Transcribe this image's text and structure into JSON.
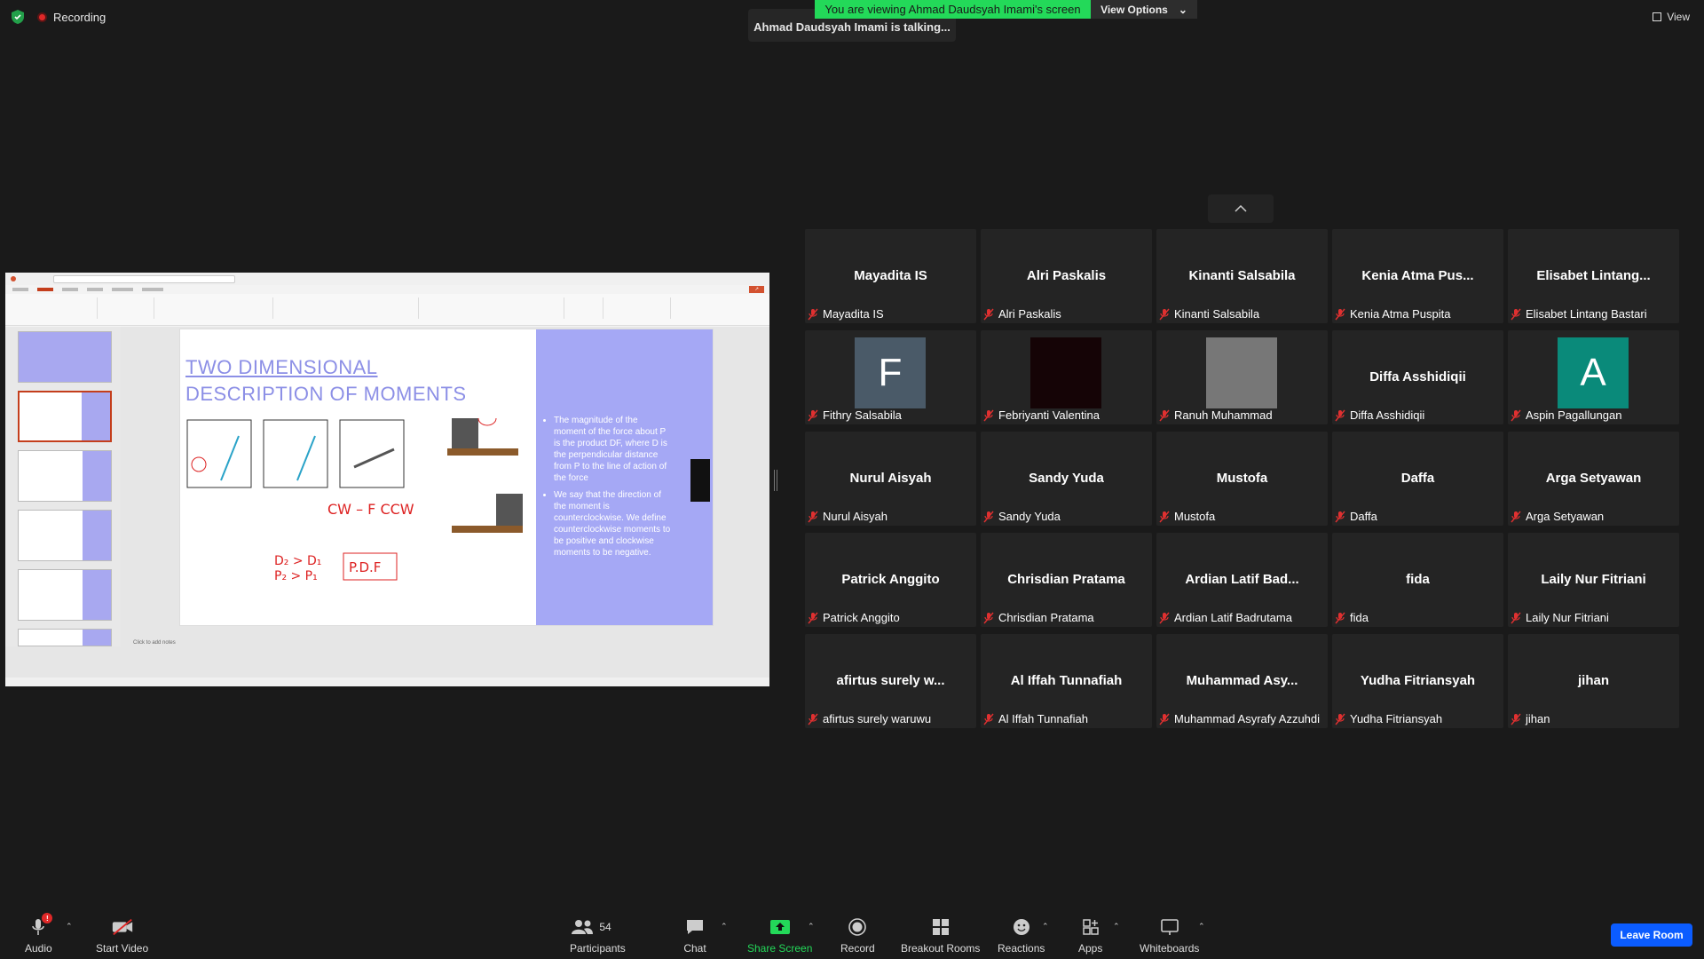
{
  "recording": {
    "label": "Recording"
  },
  "banner": {
    "viewing": "You are viewing Ahmad Daudsyah Imami's screen",
    "view_options": "View Options",
    "talking": "Ahmad Daudsyah Imami is talking..."
  },
  "top_right": {
    "view_label": "View"
  },
  "slide": {
    "title_line1": "TWO DIMENSIONAL",
    "title_line2": "DESCRIPTION OF MOMENTS",
    "bullet1": "The magnitude of the moment of the force about P is the product DF, where D is the perpendicular distance from P to the line of action of the force",
    "bullet2": "We say that the direction of the moment is counterclockwise. We define counterclockwise moments to be positive and clockwise moments to be negative.",
    "notes_placeholder": "Click to add notes"
  },
  "participants_tiles": [
    {
      "big": "Mayadita IS",
      "name": "Mayadita IS"
    },
    {
      "big": "Alri Paskalis",
      "name": "Alri Paskalis"
    },
    {
      "big": "Kinanti Salsabila",
      "name": "Kinanti Salsabila"
    },
    {
      "big": "Kenia Atma Pus...",
      "name": "Kenia Atma Puspita"
    },
    {
      "big": "Elisabet  Lintang...",
      "name": "Elisabet Lintang Bastari"
    },
    {
      "big": "F",
      "name": "Fithry Salsabila",
      "avatar_color": "#4a5a68"
    },
    {
      "big": "",
      "name": "Febriyanti Valentina",
      "avatar_color": "#150406"
    },
    {
      "big": "",
      "name": "Ranuh Muhammad",
      "avatar_color": "#777777"
    },
    {
      "big": "Diffa Asshidiqii",
      "name": "Diffa Asshidiqii"
    },
    {
      "big": "A",
      "name": "Aspin Pagallungan",
      "avatar_color": "#0a8a7a"
    },
    {
      "big": "Nurul Aisyah",
      "name": "Nurul Aisyah"
    },
    {
      "big": "Sandy Yuda",
      "name": "Sandy Yuda"
    },
    {
      "big": "Mustofa",
      "name": "Mustofa"
    },
    {
      "big": "Daffa",
      "name": "Daffa"
    },
    {
      "big": "Arga Setyawan",
      "name": "Arga Setyawan"
    },
    {
      "big": "Patrick Anggito",
      "name": "Patrick Anggito"
    },
    {
      "big": "Chrisdian Pratama",
      "name": "Chrisdian Pratama"
    },
    {
      "big": "Ardian Latif Bad...",
      "name": "Ardian Latif Badrutama"
    },
    {
      "big": "fida",
      "name": "fida"
    },
    {
      "big": "Laily Nur Fitriani",
      "name": "Laily Nur Fitriani"
    },
    {
      "big": "afirtus surely w...",
      "name": "afirtus surely waruwu"
    },
    {
      "big": "Al Iffah Tunnafiah",
      "name": "Al Iffah Tunnafiah"
    },
    {
      "big": "Muhammad  Asy...",
      "name": "Muhammad Asyrafy Azzuhdi"
    },
    {
      "big": "Yudha Fitriansyah",
      "name": "Yudha Fitriansyah"
    },
    {
      "big": "jihan",
      "name": "jihan"
    }
  ],
  "toolbar": {
    "audio": "Audio",
    "audio_badge": "!",
    "start_video": "Start Video",
    "participants": "Participants",
    "participants_count": "54",
    "chat": "Chat",
    "share_screen": "Share Screen",
    "record": "Record",
    "breakout_rooms": "Breakout Rooms",
    "reactions": "Reactions",
    "apps": "Apps",
    "whiteboards": "Whiteboards",
    "leave_room": "Leave Room"
  },
  "colors": {
    "banner_green": "#23d959",
    "leave_blue": "#0b5cff",
    "slide_purple": "#a5a8f5",
    "tile_bg": "#242424"
  }
}
